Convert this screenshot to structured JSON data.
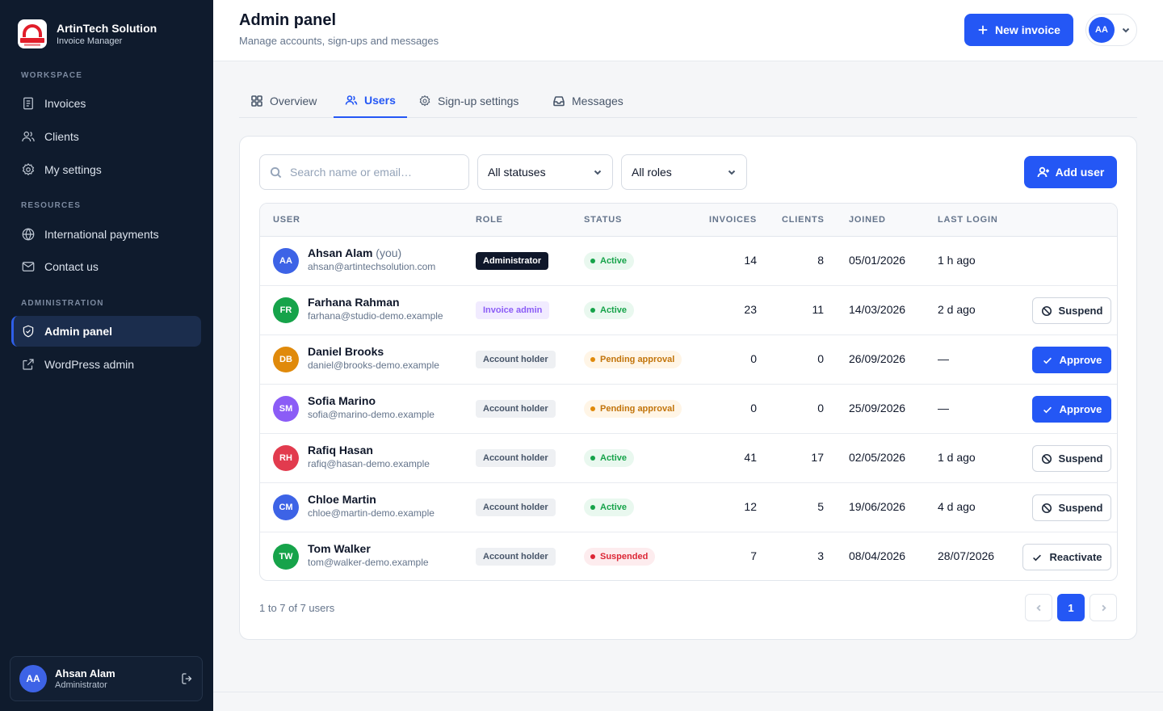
{
  "brand": {
    "name": "ArtinTech Solution",
    "subtitle": "Invoice Manager"
  },
  "sidebar": {
    "sections": [
      "WORKSPACE",
      "RESOURCES",
      "ADMINISTRATION"
    ],
    "items": [
      {
        "label": "Invoices",
        "icon": "invoice-icon"
      },
      {
        "label": "Clients",
        "icon": "users-icon"
      },
      {
        "label": "My settings",
        "icon": "gear-icon"
      },
      {
        "label": "International payments",
        "icon": "globe-icon"
      },
      {
        "label": "Contact us",
        "icon": "mail-icon"
      },
      {
        "label": "Admin panel",
        "icon": "shield-icon",
        "active": true
      },
      {
        "label": "WordPress admin",
        "icon": "external-link-icon"
      }
    ],
    "user": {
      "initials": "AA",
      "name": "Ahsan Alam",
      "role": "Administrator"
    }
  },
  "header": {
    "title": "Admin panel",
    "subtitle": "Manage accounts, sign-ups and messages",
    "new_invoice_label": "New invoice",
    "account_initials": "AA"
  },
  "tabs": [
    {
      "label": "Overview",
      "icon": "grid-icon"
    },
    {
      "label": "Users",
      "icon": "users-icon",
      "active": true
    },
    {
      "label": "Sign-up settings",
      "icon": "gear-icon"
    },
    {
      "label": "Messages",
      "icon": "inbox-icon"
    }
  ],
  "filters": {
    "search_placeholder": "Search name or email…",
    "status_value": "All statuses",
    "role_value": "All roles",
    "add_user_label": "Add user"
  },
  "table": {
    "columns": [
      "USER",
      "ROLE",
      "STATUS",
      "INVOICES",
      "CLIENTS",
      "JOINED",
      "LAST LOGIN"
    ],
    "you_label": "(you)",
    "rows": [
      {
        "initials": "AA",
        "name": "Ahsan Alam",
        "you": true,
        "email": "ahsan@artintechsolution.com",
        "role": "Administrator",
        "status": "Active",
        "invoices": "14",
        "clients": "8",
        "joined": "05/01/2026",
        "last_login": "1 h ago",
        "action": ""
      },
      {
        "initials": "FR",
        "name": "Farhana Rahman",
        "email": "farhana@studio-demo.example",
        "role": "Invoice admin",
        "status": "Active",
        "invoices": "23",
        "clients": "11",
        "joined": "14/03/2026",
        "last_login": "2 d ago",
        "action": "Suspend"
      },
      {
        "initials": "DB",
        "name": "Daniel Brooks",
        "email": "daniel@brooks-demo.example",
        "role": "Account holder",
        "status": "Pending approval",
        "invoices": "0",
        "clients": "0",
        "joined": "26/09/2026",
        "last_login": "—",
        "action": "Approve"
      },
      {
        "initials": "SM",
        "name": "Sofia Marino",
        "email": "sofia@marino-demo.example",
        "role": "Account holder",
        "status": "Pending approval",
        "invoices": "0",
        "clients": "0",
        "joined": "25/09/2026",
        "last_login": "—",
        "action": "Approve"
      },
      {
        "initials": "RH",
        "name": "Rafiq Hasan",
        "email": "rafiq@hasan-demo.example",
        "role": "Account holder",
        "status": "Active",
        "invoices": "41",
        "clients": "17",
        "joined": "02/05/2026",
        "last_login": "1 d ago",
        "action": "Suspend"
      },
      {
        "initials": "CM",
        "name": "Chloe Martin",
        "email": "chloe@martin-demo.example",
        "role": "Account holder",
        "status": "Active",
        "invoices": "12",
        "clients": "5",
        "joined": "19/06/2026",
        "last_login": "4 d ago",
        "action": "Suspend"
      },
      {
        "initials": "TW",
        "name": "Tom Walker",
        "email": "tom@walker-demo.example",
        "role": "Account holder",
        "status": "Suspended",
        "invoices": "7",
        "clients": "3",
        "joined": "08/04/2026",
        "last_login": "28/07/2026",
        "action": "Reactivate"
      }
    ]
  },
  "pagination": {
    "summary": "1 to 7 of 7 users",
    "current_page": "1"
  },
  "colors": {
    "accent": "#2457f5",
    "sidebar_bg": "#0f1b2d",
    "avatar_AA": "#3d63e6",
    "avatar_FR": "#16a34a",
    "avatar_DB": "#e08a0b",
    "avatar_SM": "#8b5cf6",
    "avatar_RH": "#e23b4e",
    "avatar_CM": "#3d63e6",
    "avatar_TW": "#16a34a"
  }
}
